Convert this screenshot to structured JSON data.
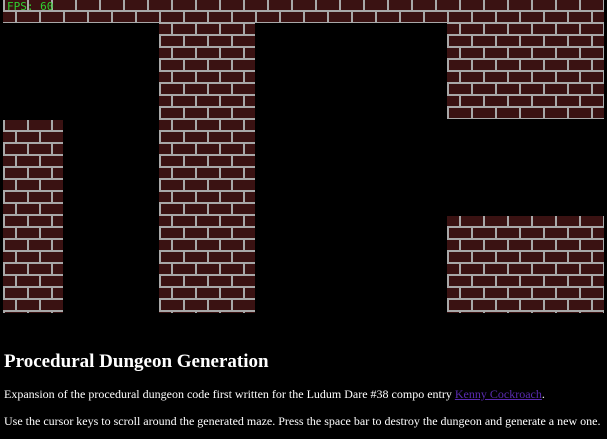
{
  "game": {
    "fps_text": "FPS: 60",
    "brick_color": "#3a1212",
    "mortar_color": "#a8a8a8",
    "background_color": "#000000"
  },
  "article": {
    "title": "Procedural Dungeon Generation",
    "intro_text": "Expansion of the procedural dungeon code first written for the Ludum Dare #38 compo entry ",
    "link_text": "Kenny Cockroach",
    "intro_end": ".",
    "instructions": "Use the cursor keys to scroll around the generated maze. Press the space bar to destroy the dungeon and generate a new one."
  }
}
